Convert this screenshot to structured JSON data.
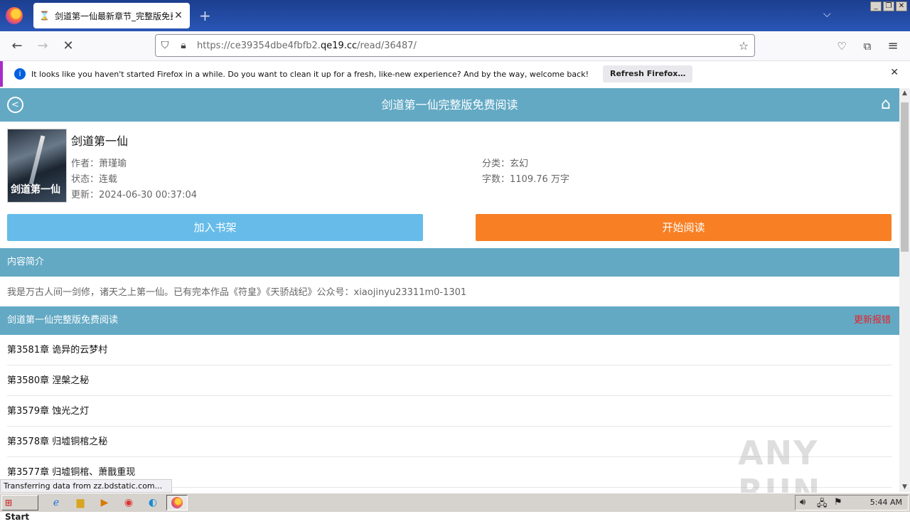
{
  "browser": {
    "tab_title": "剑道第一仙最新章节_完整版免费阅读",
    "url_prefix": "https://ce39354dbe4fbfb2.",
    "url_domain": "qe19.cc",
    "url_path": "/read/36487/",
    "notification": "It looks like you haven't started Firefox in a while. Do you want to clean it up for a fresh, like-new experience? And by the way, welcome back!",
    "refresh_button": "Refresh Firefox…",
    "status_text": "Transferring data from zz.bdstatic.com..."
  },
  "site": {
    "header_title": "剑道第一仙完整版免费阅读",
    "book": {
      "title": "剑道第一仙",
      "cover_text": "剑道第一仙",
      "author": "作者：萧瑾瑜",
      "status": "状态：连载",
      "updated": "更新：2024-06-30 00:37:04",
      "category": "分类：玄幻",
      "word_count": "字数：1109.76 万字"
    },
    "buttons": {
      "shelf": "加入书架",
      "read": "开始阅读"
    },
    "intro_header": "内容简介",
    "intro_text": "我是万古人间一剑修，诸天之上第一仙。已有完本作品《符皇》《天骄战纪》公众号：xiaojinyu23311m0-1301",
    "chapters_header": "剑道第一仙完整版免费阅读",
    "report_link": "更新报错",
    "chapters": [
      "第3581章 诡异的云梦村",
      "第3580章 涅槃之秘",
      "第3579章 蚀光之灯",
      "第3578章 归墟铜棺之秘",
      "第3577章 归墟铜棺、萧戬重现"
    ]
  },
  "taskbar": {
    "start": "Start",
    "clock": "5:44 AM"
  },
  "watermark": "ANY RUN"
}
